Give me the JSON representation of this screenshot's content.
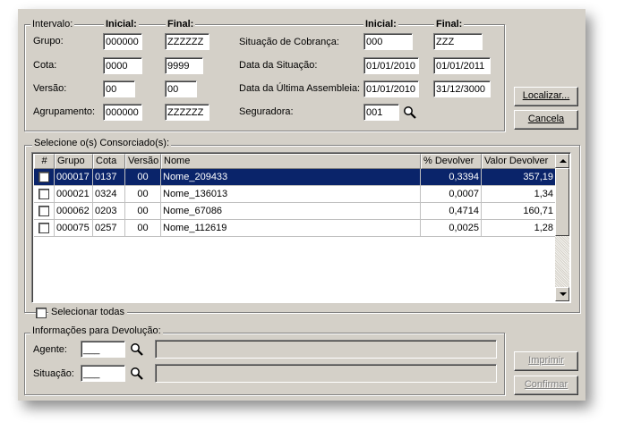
{
  "filter": {
    "legend": "Intervalo:",
    "inicial": "Inicial:",
    "final": "Final:",
    "left": [
      {
        "label": "Grupo:",
        "ini": "000000",
        "fim": "ZZZZZZ"
      },
      {
        "label": "Cota:",
        "ini": "0000",
        "fim": "9999"
      },
      {
        "label": "Versão:",
        "ini": "00",
        "fim": "00"
      },
      {
        "label": "Agrupamento:",
        "ini": "000000",
        "fim": "ZZZZZZ"
      }
    ],
    "right": [
      {
        "label": "Situação de Cobrança:",
        "ini": "000",
        "fim": "ZZZ"
      },
      {
        "label": "Data da Situação:",
        "ini": "01/01/2010",
        "fim": "01/01/2011"
      },
      {
        "label": "Data da Última Assembleia:",
        "ini": "01/01/2010",
        "fim": "31/12/3000"
      }
    ],
    "seguradora": {
      "label": "Seguradora:",
      "value": "001"
    }
  },
  "buttons": {
    "localizar": "Localizar...",
    "cancela": "Cancela",
    "imprimir": "Imprimir",
    "confirmar": "Confirmar"
  },
  "grid": {
    "legend": "Selecione o(s) Consorciado(s):",
    "columns": [
      "#",
      "Grupo",
      "Cota",
      "Versão",
      "Nome",
      "% Devolver",
      "Valor Devolver"
    ],
    "rows": [
      {
        "grupo": "000017",
        "cota": "0137",
        "versao": "00",
        "nome": "Nome_209433",
        "pct": "0,3394",
        "valor": "357,19",
        "selected": true
      },
      {
        "grupo": "000021",
        "cota": "0324",
        "versao": "00",
        "nome": "Nome_136013",
        "pct": "0,0007",
        "valor": "1,34",
        "selected": false
      },
      {
        "grupo": "000062",
        "cota": "0203",
        "versao": "00",
        "nome": "Nome_67086",
        "pct": "0,4714",
        "valor": "160,71",
        "selected": false
      },
      {
        "grupo": "000075",
        "cota": "0257",
        "versao": "00",
        "nome": "Nome_112619",
        "pct": "0,0025",
        "valor": "1,28",
        "selected": false
      }
    ],
    "select_all": "Selecionar todas"
  },
  "info": {
    "legend": "Informações para Devolução:",
    "agente_label": "Agente:",
    "agente_value": "___",
    "situacao_label": "Situação:",
    "situacao_value": "___"
  },
  "colors": {
    "selection": "#0a246a",
    "face": "#d4d0c8"
  }
}
